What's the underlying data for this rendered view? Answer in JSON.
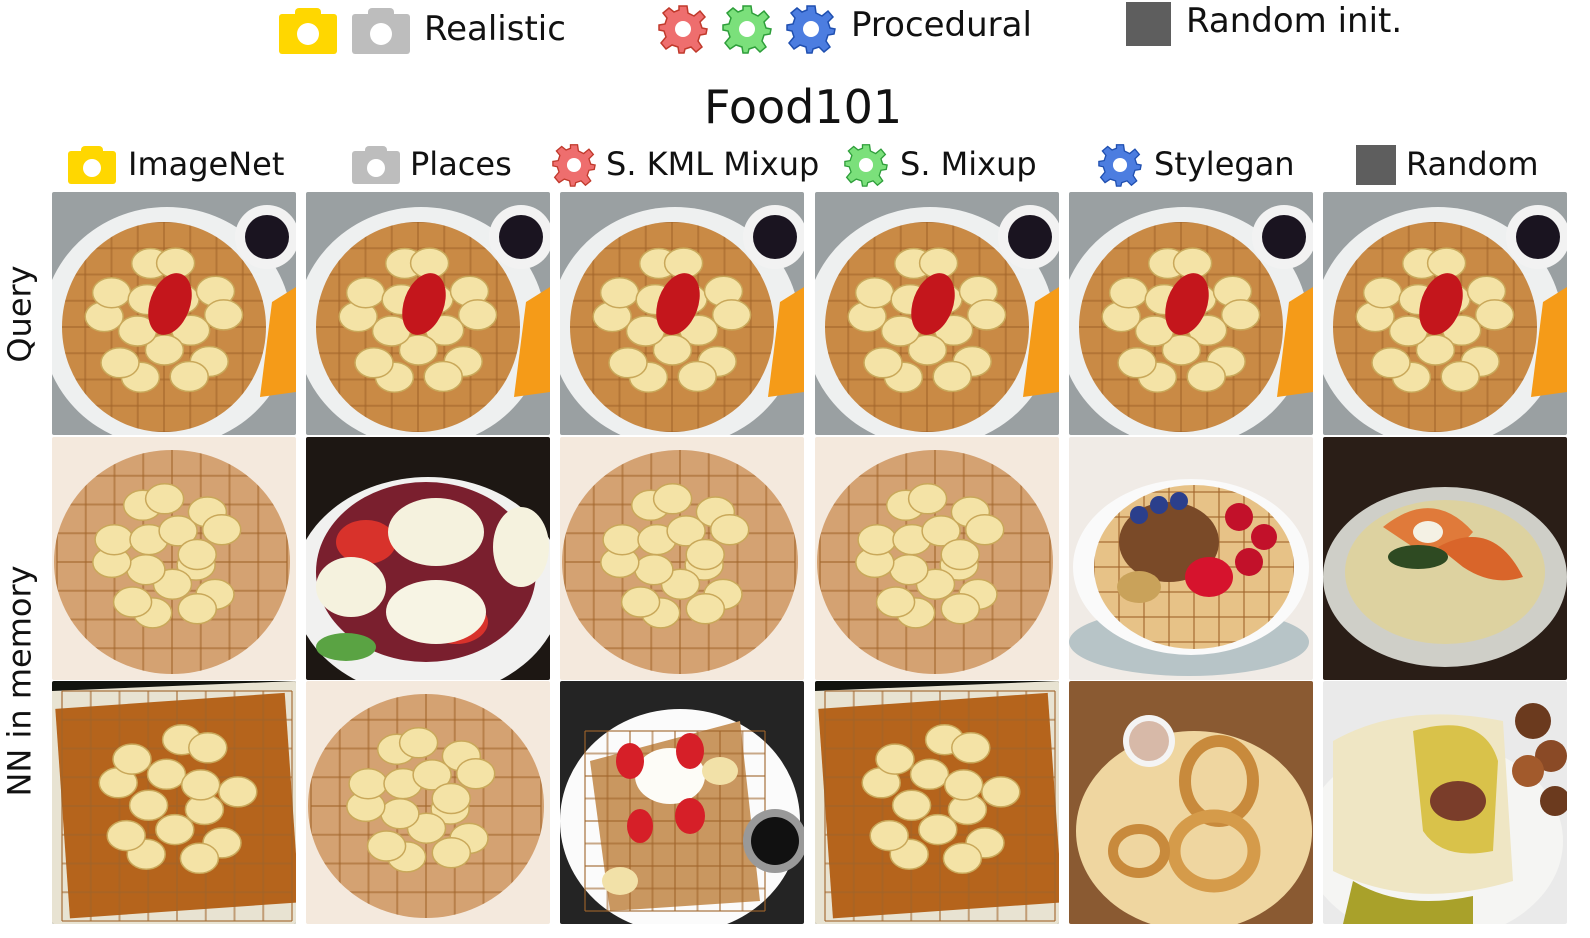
{
  "legend": {
    "realistic_label": "Realistic",
    "procedural_label": "Procedural",
    "random_label": "Random init.",
    "colors": {
      "imagenet_yellow": "#FFD700",
      "places_gray": "#BDBDBD",
      "kml_red": "#EE6E6E",
      "mixup_green": "#7BE07B",
      "stylegan_blue": "#4C7DE0",
      "random_dark": "#5E5E5E"
    }
  },
  "title": "Food101",
  "columns": [
    {
      "label": "ImageNet",
      "icon": "camera-yellow-icon"
    },
    {
      "label": "Places",
      "icon": "camera-gray-icon"
    },
    {
      "label": "S. KML Mixup",
      "icon": "gear-red-icon"
    },
    {
      "label": "S. Mixup",
      "icon": "gear-green-icon"
    },
    {
      "label": "Stylegan",
      "icon": "gear-blue-icon"
    },
    {
      "label": "Random",
      "icon": "square-dark-icon"
    }
  ],
  "rows": {
    "query_label": "Query",
    "memory_label": "NN in memory"
  },
  "images": [
    [
      "waffle-bananas-strawberry",
      "waffle-bananas-strawberry",
      "waffle-bananas-strawberry",
      "waffle-bananas-strawberry",
      "waffle-bananas-strawberry",
      "waffle-bananas-strawberry"
    ],
    [
      "waffle-bananas",
      "caprese-salad",
      "waffle-bananas",
      "waffle-bananas",
      "waffle-berries-nuts",
      "shrimp-risotto"
    ],
    [
      "waffle-bananas-tray",
      "waffle-bananas",
      "waffle-strawberries-cream",
      "waffle-bananas-tray",
      "onion-rings-dip",
      "burrito-potatoes"
    ]
  ]
}
